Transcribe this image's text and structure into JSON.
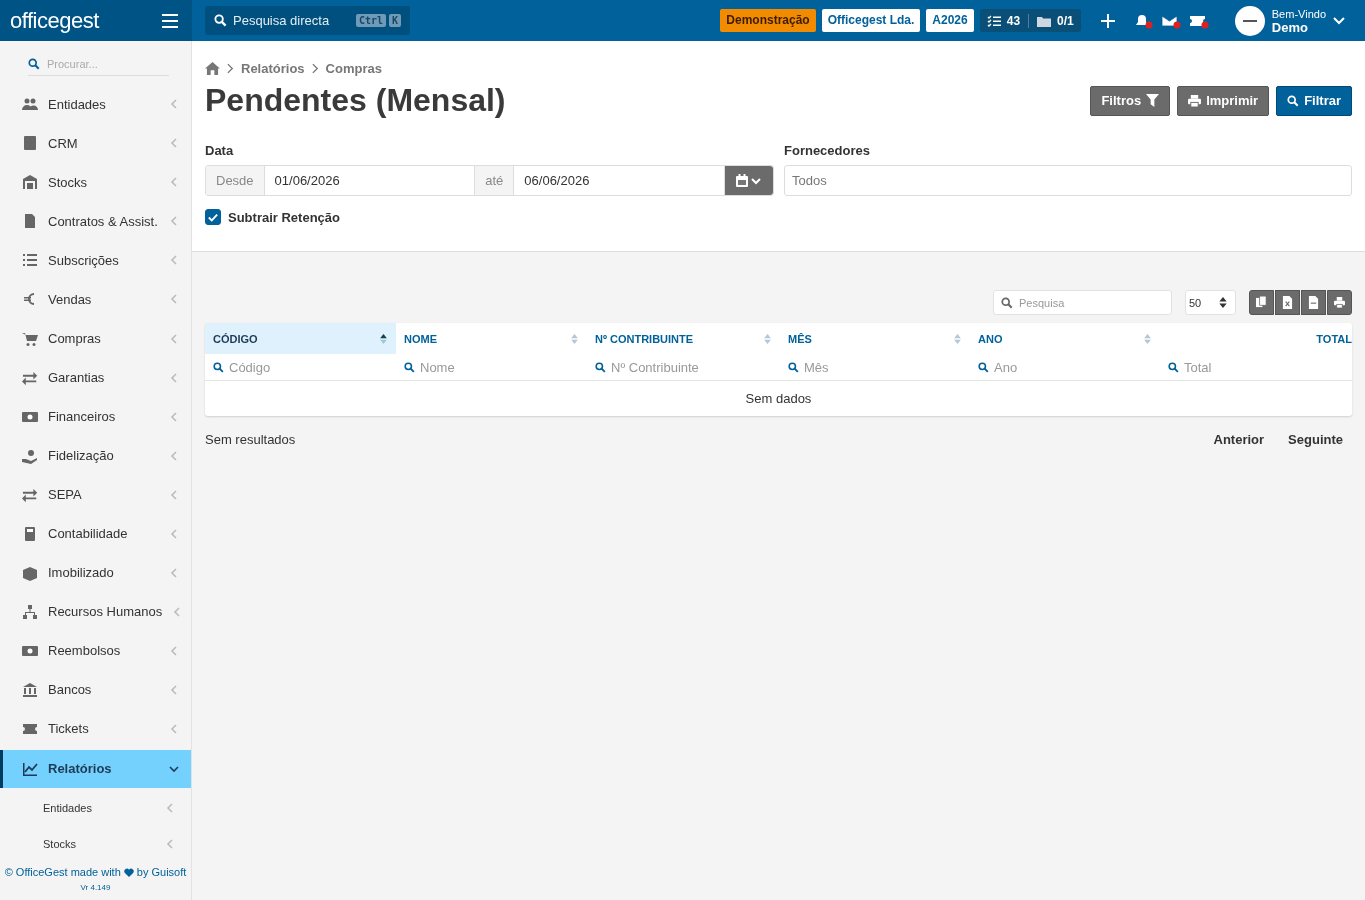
{
  "topbar": {
    "logo": "officegest",
    "search": {
      "placeholder": "Pesquisa directa",
      "keys": [
        "Ctrl",
        "K"
      ]
    },
    "badges": [
      {
        "label": "Demonstração",
        "kind": "demo"
      },
      {
        "label": "Officegest Lda.",
        "kind": "company"
      },
      {
        "label": "A2026",
        "kind": "year"
      }
    ],
    "tasks": "43",
    "folders": "0/1",
    "notifications": [
      {
        "kind": "bell",
        "unread": true
      },
      {
        "kind": "mail",
        "unread": true
      },
      {
        "kind": "ticket",
        "unread": true
      }
    ],
    "user": {
      "greeting": "Bem-Vindo",
      "name": "Demo"
    }
  },
  "sidebar": {
    "search": {
      "placeholder": "Procurar..."
    },
    "items": [
      {
        "label": "Entidades",
        "expanded": false,
        "selected": false
      },
      {
        "label": "CRM",
        "expanded": false,
        "selected": false
      },
      {
        "label": "Stocks",
        "expanded": false,
        "selected": false
      },
      {
        "label": "Contratos & Assist.",
        "expanded": false,
        "selected": false
      },
      {
        "label": "Subscrições",
        "expanded": false,
        "selected": false
      },
      {
        "label": "Vendas",
        "expanded": false,
        "selected": false
      },
      {
        "label": "Compras",
        "expanded": false,
        "selected": false
      },
      {
        "label": "Garantias",
        "expanded": false,
        "selected": false
      },
      {
        "label": "Financeiros",
        "expanded": false,
        "selected": false
      },
      {
        "label": "Fidelização",
        "expanded": false,
        "selected": false
      },
      {
        "label": "SEPA",
        "expanded": false,
        "selected": false
      },
      {
        "label": "Contabilidade",
        "expanded": false,
        "selected": false
      },
      {
        "label": "Imobilizado",
        "expanded": false,
        "selected": false
      },
      {
        "label": "Recursos Humanos",
        "expanded": false,
        "selected": false
      },
      {
        "label": "Reembolsos",
        "expanded": false,
        "selected": false
      },
      {
        "label": "Bancos",
        "expanded": false,
        "selected": false
      },
      {
        "label": "Tickets",
        "expanded": false,
        "selected": false
      },
      {
        "label": "Relatórios",
        "expanded": true,
        "selected": true,
        "children": [
          {
            "label": "Entidades"
          },
          {
            "label": "Stocks"
          }
        ]
      }
    ],
    "footer": {
      "credit_before": "© OfficeGest made with",
      "credit_after": "by Guisoft",
      "version": "Vr 4.149"
    }
  },
  "breadcrumb": [
    "Relatórios",
    "Compras"
  ],
  "title": "Pendentes (Mensal)",
  "actions": [
    {
      "label": "Filtros",
      "kind": "filters"
    },
    {
      "label": "Imprimir",
      "kind": "print"
    },
    {
      "label": "Filtrar",
      "kind": "filter"
    }
  ],
  "filters": {
    "date_label": "Data",
    "from_label": "Desde",
    "from": "01/06/2026",
    "to_label": "até",
    "to": "06/06/2026",
    "suppliers_label": "Fornecedores",
    "suppliers_placeholder": "Todos",
    "subtract": {
      "label": "Subtrair Retenção",
      "checked": true
    }
  },
  "table": {
    "search_placeholder": "Pesquisa",
    "page_size": "50",
    "columns": [
      {
        "label": "CÓDIGO",
        "filter": "Código",
        "sorted": true
      },
      {
        "label": "NOME",
        "filter": "Nome",
        "sorted": false
      },
      {
        "label": "Nº CONTRIBUINTE",
        "filter": "Nº Contribuinte",
        "sorted": false
      },
      {
        "label": "MÊS",
        "filter": "Mês",
        "sorted": false
      },
      {
        "label": "ANO",
        "filter": "Ano",
        "sorted": false
      },
      {
        "label": "TOTAL",
        "filter": "Total",
        "sorted": false
      }
    ],
    "empty": "Sem dados",
    "info": "Sem resultados",
    "prev": "Anterior",
    "next": "Seguinte"
  }
}
